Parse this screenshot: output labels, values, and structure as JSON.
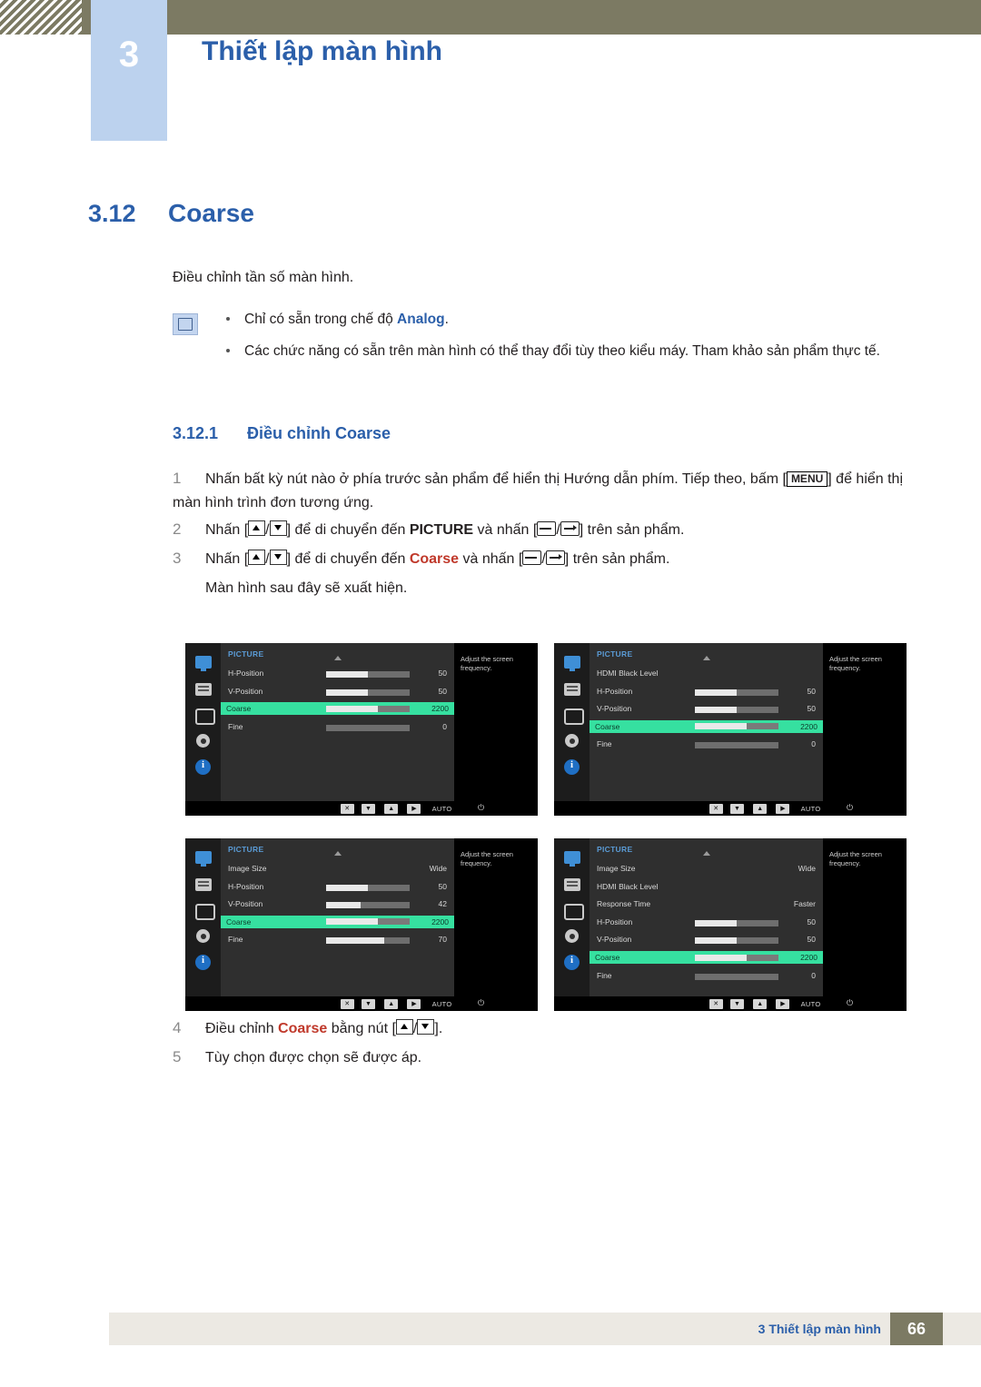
{
  "header": {
    "chapter_number": "3",
    "chapter_title": "Thiết lập màn hình"
  },
  "section": {
    "number": "3.12",
    "title": "Coarse"
  },
  "intro": "Điều chỉnh tần số màn hình.",
  "notes": [
    {
      "prefix": "Chỉ có sẵn trong chế độ ",
      "bold": "Analog",
      "suffix": "."
    },
    {
      "prefix": "Các chức năng có sẵn trên màn hình có thể thay đổi tùy theo kiểu máy. Tham khảo sản phẩm thực tế.",
      "bold": "",
      "suffix": ""
    }
  ],
  "subsection": {
    "number": "3.12.1",
    "title": "Điều chỉnh Coarse"
  },
  "steps": [
    {
      "n": "1",
      "html": "Nhấn bất kỳ nút nào ở phía trước sản phẩm để hiển thị Hướng dẫn phím. Tiếp theo, bấm [<span class='kbd'>MENU</span>] để hiển thị màn hình trình đơn tương ứng."
    },
    {
      "n": "2",
      "html": "Nhấn [<span class='arrow-box up'></span>/<span class='arrow-box down'></span>] để di chuyển đến <b>PICTURE</b> và nhấn [<span class='ebox e1'></span>/<span class='ebox e2'></span>] trên sản phẩm."
    },
    {
      "n": "3",
      "html": "Nhấn [<span class='arrow-box up'></span>/<span class='arrow-box down'></span>] để di chuyển đến <b class='red'>Coarse</b> và nhấn [<span class='ebox e1'></span>/<span class='ebox e2'></span>] trên sản phẩm."
    }
  ],
  "step3_sub": "Màn hình sau đây sẽ xuất hiện.",
  "steps_after": [
    {
      "n": "4",
      "html": "Điều chỉnh <b class='red'>Coarse</b> bằng nút [<span class='arrow-box up'></span>/<span class='arrow-box down'></span>]."
    },
    {
      "n": "5",
      "html": "Tùy chọn được chọn sẽ được áp."
    }
  ],
  "osd_common": {
    "menu_title": "PICTURE",
    "help_text": "Adjust the screen frequency.",
    "footer_auto": "AUTO",
    "footer_power": "⏻"
  },
  "osd_panels": [
    {
      "id": "osd-1",
      "title": "PICTURE",
      "rows": [
        {
          "label": "H-Position",
          "value": "50",
          "fill": 50,
          "selected": false
        },
        {
          "label": "V-Position",
          "value": "50",
          "fill": 50,
          "selected": false
        },
        {
          "label": "Coarse",
          "value": "2200",
          "fill": 62,
          "selected": true
        },
        {
          "label": "Fine",
          "value": "0",
          "fill": 0,
          "selected": false
        }
      ]
    },
    {
      "id": "osd-2",
      "title": "PICTURE",
      "rows": [
        {
          "label": "HDMI Black Level",
          "value": "",
          "fill": -1,
          "selected": false
        },
        {
          "label": "H-Position",
          "value": "50",
          "fill": 50,
          "selected": false
        },
        {
          "label": "V-Position",
          "value": "50",
          "fill": 50,
          "selected": false
        },
        {
          "label": "Coarse",
          "value": "2200",
          "fill": 62,
          "selected": true
        },
        {
          "label": "Fine",
          "value": "0",
          "fill": 0,
          "selected": false
        }
      ]
    },
    {
      "id": "osd-3",
      "title": "PICTURE",
      "rows": [
        {
          "label": "Image Size",
          "value": "Wide",
          "fill": -1,
          "selected": false
        },
        {
          "label": "H-Position",
          "value": "50",
          "fill": 50,
          "selected": false
        },
        {
          "label": "V-Position",
          "value": "42",
          "fill": 42,
          "selected": false
        },
        {
          "label": "Coarse",
          "value": "2200",
          "fill": 62,
          "selected": true
        },
        {
          "label": "Fine",
          "value": "70",
          "fill": 70,
          "selected": false
        }
      ]
    },
    {
      "id": "osd-4",
      "title": "PICTURE",
      "rows": [
        {
          "label": "Image Size",
          "value": "Wide",
          "fill": -1,
          "selected": false
        },
        {
          "label": "HDMI Black Level",
          "value": "",
          "fill": -1,
          "selected": false
        },
        {
          "label": "Response Time",
          "value": "Faster",
          "fill": -1,
          "selected": false
        },
        {
          "label": "H-Position",
          "value": "50",
          "fill": 50,
          "selected": false
        },
        {
          "label": "V-Position",
          "value": "50",
          "fill": 50,
          "selected": false
        },
        {
          "label": "Coarse",
          "value": "2200",
          "fill": 62,
          "selected": true
        },
        {
          "label": "Fine",
          "value": "0",
          "fill": 0,
          "selected": false
        }
      ]
    }
  ],
  "footer": {
    "text": "3 Thiết lập màn hình",
    "page": "66"
  }
}
